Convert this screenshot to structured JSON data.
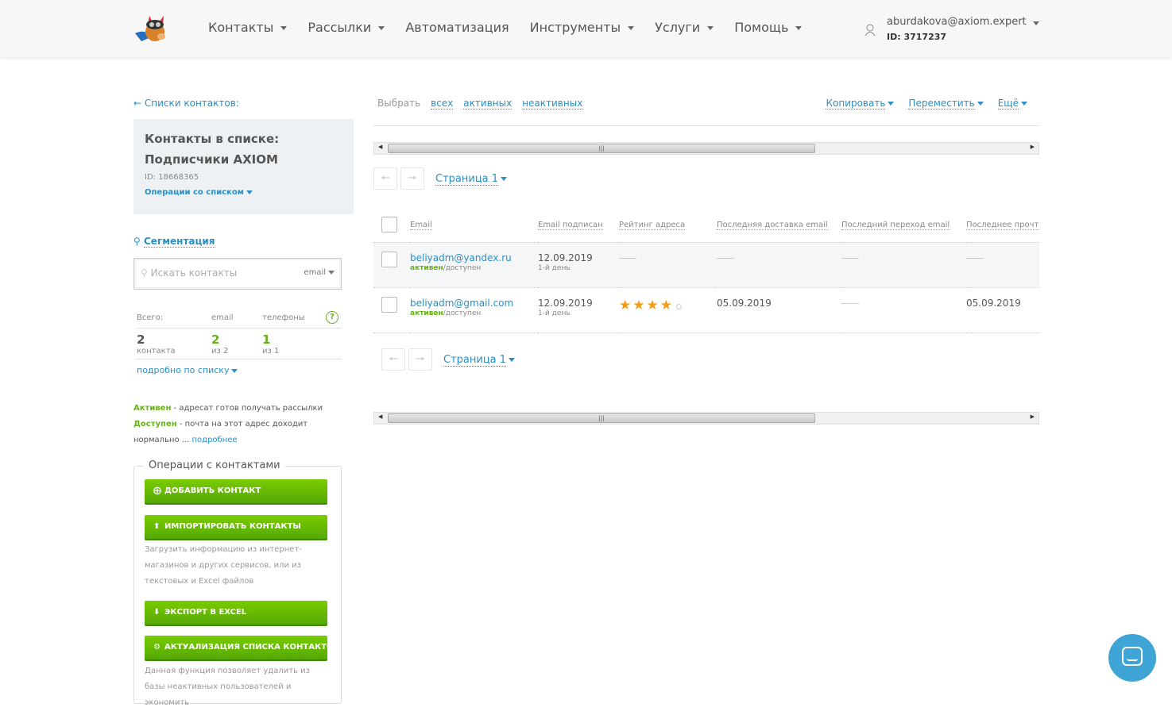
{
  "header": {
    "nav": [
      "Контакты",
      "Рассылки",
      "Автоматизация",
      "Инструменты",
      "Услуги",
      "Помощь"
    ],
    "nav_caret": [
      true,
      true,
      false,
      true,
      true,
      true
    ],
    "user_email": "aburdakova@axiom.expert",
    "user_id": "ID: 3717237"
  },
  "sidebar": {
    "back": "← Списки контактов:",
    "list_title_1": "Контакты в списке:",
    "list_title_2": "Подписчики AXIOM",
    "list_id": "ID: 18668365",
    "list_ops": "Операции со списком",
    "segmentation": "Сегментация",
    "search_placeholder": "Искать контакты",
    "search_field": "email",
    "stats": {
      "h_total": "Всего:",
      "h_email": "email",
      "h_phones": "телефоны",
      "total": "2",
      "total_sub": "контакта",
      "email": "2",
      "email_sub": "из 2",
      "phones": "1",
      "phones_sub": "из 1",
      "details": "подробно по списку"
    },
    "legend": {
      "active": "Активен",
      "active_text": " - адресат готов получать рассылки",
      "avail": "Доступен",
      "avail_text": " - почта на этот адрес доходит нормально ... ",
      "more": "подробнее"
    },
    "ops": {
      "title": "Операции с контактами",
      "add": "ДОБАВИТЬ КОНТАКТ",
      "import": "ИМПОРТИРОВАТЬ КОНТАКТЫ",
      "import_desc": "Загрузить информацию из интернет-магазинов и других сервисов, или из текстовых и Excel файлов",
      "export": "ЭКСПОРТ В EXCEL",
      "actualize": "АКТУАЛИЗАЦИЯ СПИСКА КОНТАКТОВ",
      "actualize_desc": "Данная функция позволяет удалить из базы неактивных пользователей и экономить"
    }
  },
  "main": {
    "select_label": "Выбрать",
    "select_all": "всех",
    "select_active": "активных",
    "select_inactive": "неактивных",
    "copy": "Копировать",
    "move": "Переместить",
    "more": "Ещё",
    "page": "Страница 1",
    "columns": [
      "Email",
      "Email подписан",
      "Рейтинг адреса",
      "Последняя доставка email",
      "Последний переход email",
      "Последнее прочтение"
    ],
    "rows": [
      {
        "email": "beliyadm@yandex.ru",
        "status_active": "активен",
        "status_rest": "/доступен",
        "subscribed": "12.09.2019",
        "sub_day": "1-й день",
        "rating": 0,
        "last_delivery": "",
        "last_click": "",
        "last_read": ""
      },
      {
        "email": "beliyadm@gmail.com",
        "status_active": "активен",
        "status_rest": "/доступен",
        "subscribed": "12.09.2019",
        "sub_day": "1-й день",
        "rating": 4,
        "last_delivery": "05.09.2019",
        "last_click": "",
        "last_read": "05.09.2019"
      }
    ]
  }
}
